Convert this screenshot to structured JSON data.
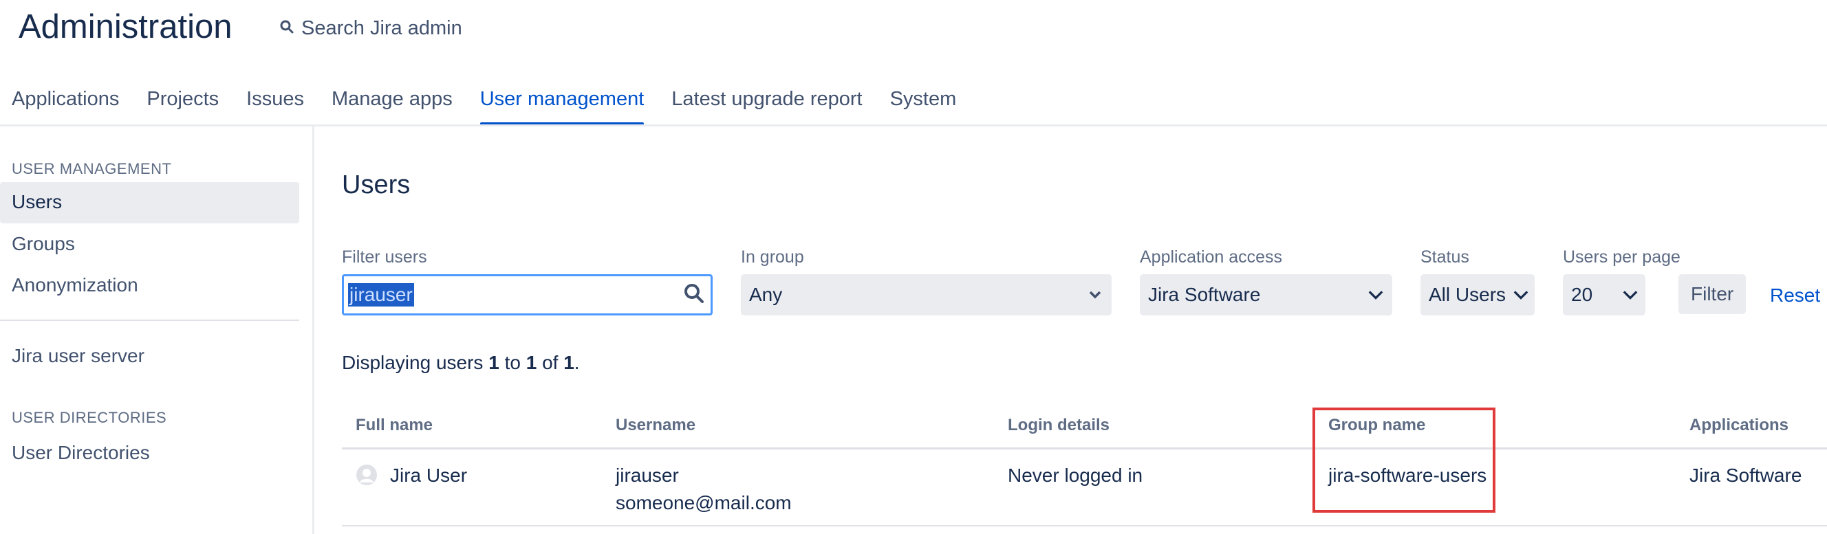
{
  "header": {
    "title": "Administration",
    "search_placeholder": "Search Jira admin"
  },
  "topnav": {
    "tabs": [
      {
        "label": "Applications"
      },
      {
        "label": "Projects"
      },
      {
        "label": "Issues"
      },
      {
        "label": "Manage apps"
      },
      {
        "label": "User management",
        "active": true
      },
      {
        "label": "Latest upgrade report"
      },
      {
        "label": "System"
      }
    ]
  },
  "sidebar": {
    "section1_heading": "USER MANAGEMENT",
    "items1": [
      "Users",
      "Groups",
      "Anonymization"
    ],
    "item_standalone": "Jira user server",
    "section2_heading": "USER DIRECTORIES",
    "items2": [
      "User Directories"
    ],
    "active_item": "Users"
  },
  "main": {
    "title": "Users",
    "filters": {
      "filter_users_label": "Filter users",
      "filter_users_value": "jirauser",
      "in_group_label": "In group",
      "in_group_value": "Any",
      "app_access_label": "Application access",
      "app_access_value": "Jira Software",
      "status_label": "Status",
      "status_value": "All Users",
      "per_page_label": "Users per page",
      "per_page_value": "20",
      "filter_button": "Filter",
      "reset_link": "Reset"
    },
    "display": {
      "prefix": "Displaying users",
      "from": "1",
      "to_word": "to",
      "to": "1",
      "of_word": "of",
      "total": "1",
      "suffix": "."
    },
    "table": {
      "columns": [
        "Full name",
        "Username",
        "Login details",
        "Group name",
        "Applications"
      ],
      "rows": [
        {
          "full_name": "Jira User",
          "username": "jirauser",
          "email": "someone@mail.com",
          "login_details": "Never logged in",
          "group_name": "jira-software-users",
          "applications": "Jira Software"
        }
      ]
    }
  },
  "colors": {
    "accent": "#0052cc",
    "highlight": "#e03a3a",
    "selection": "#1d5ec9"
  }
}
